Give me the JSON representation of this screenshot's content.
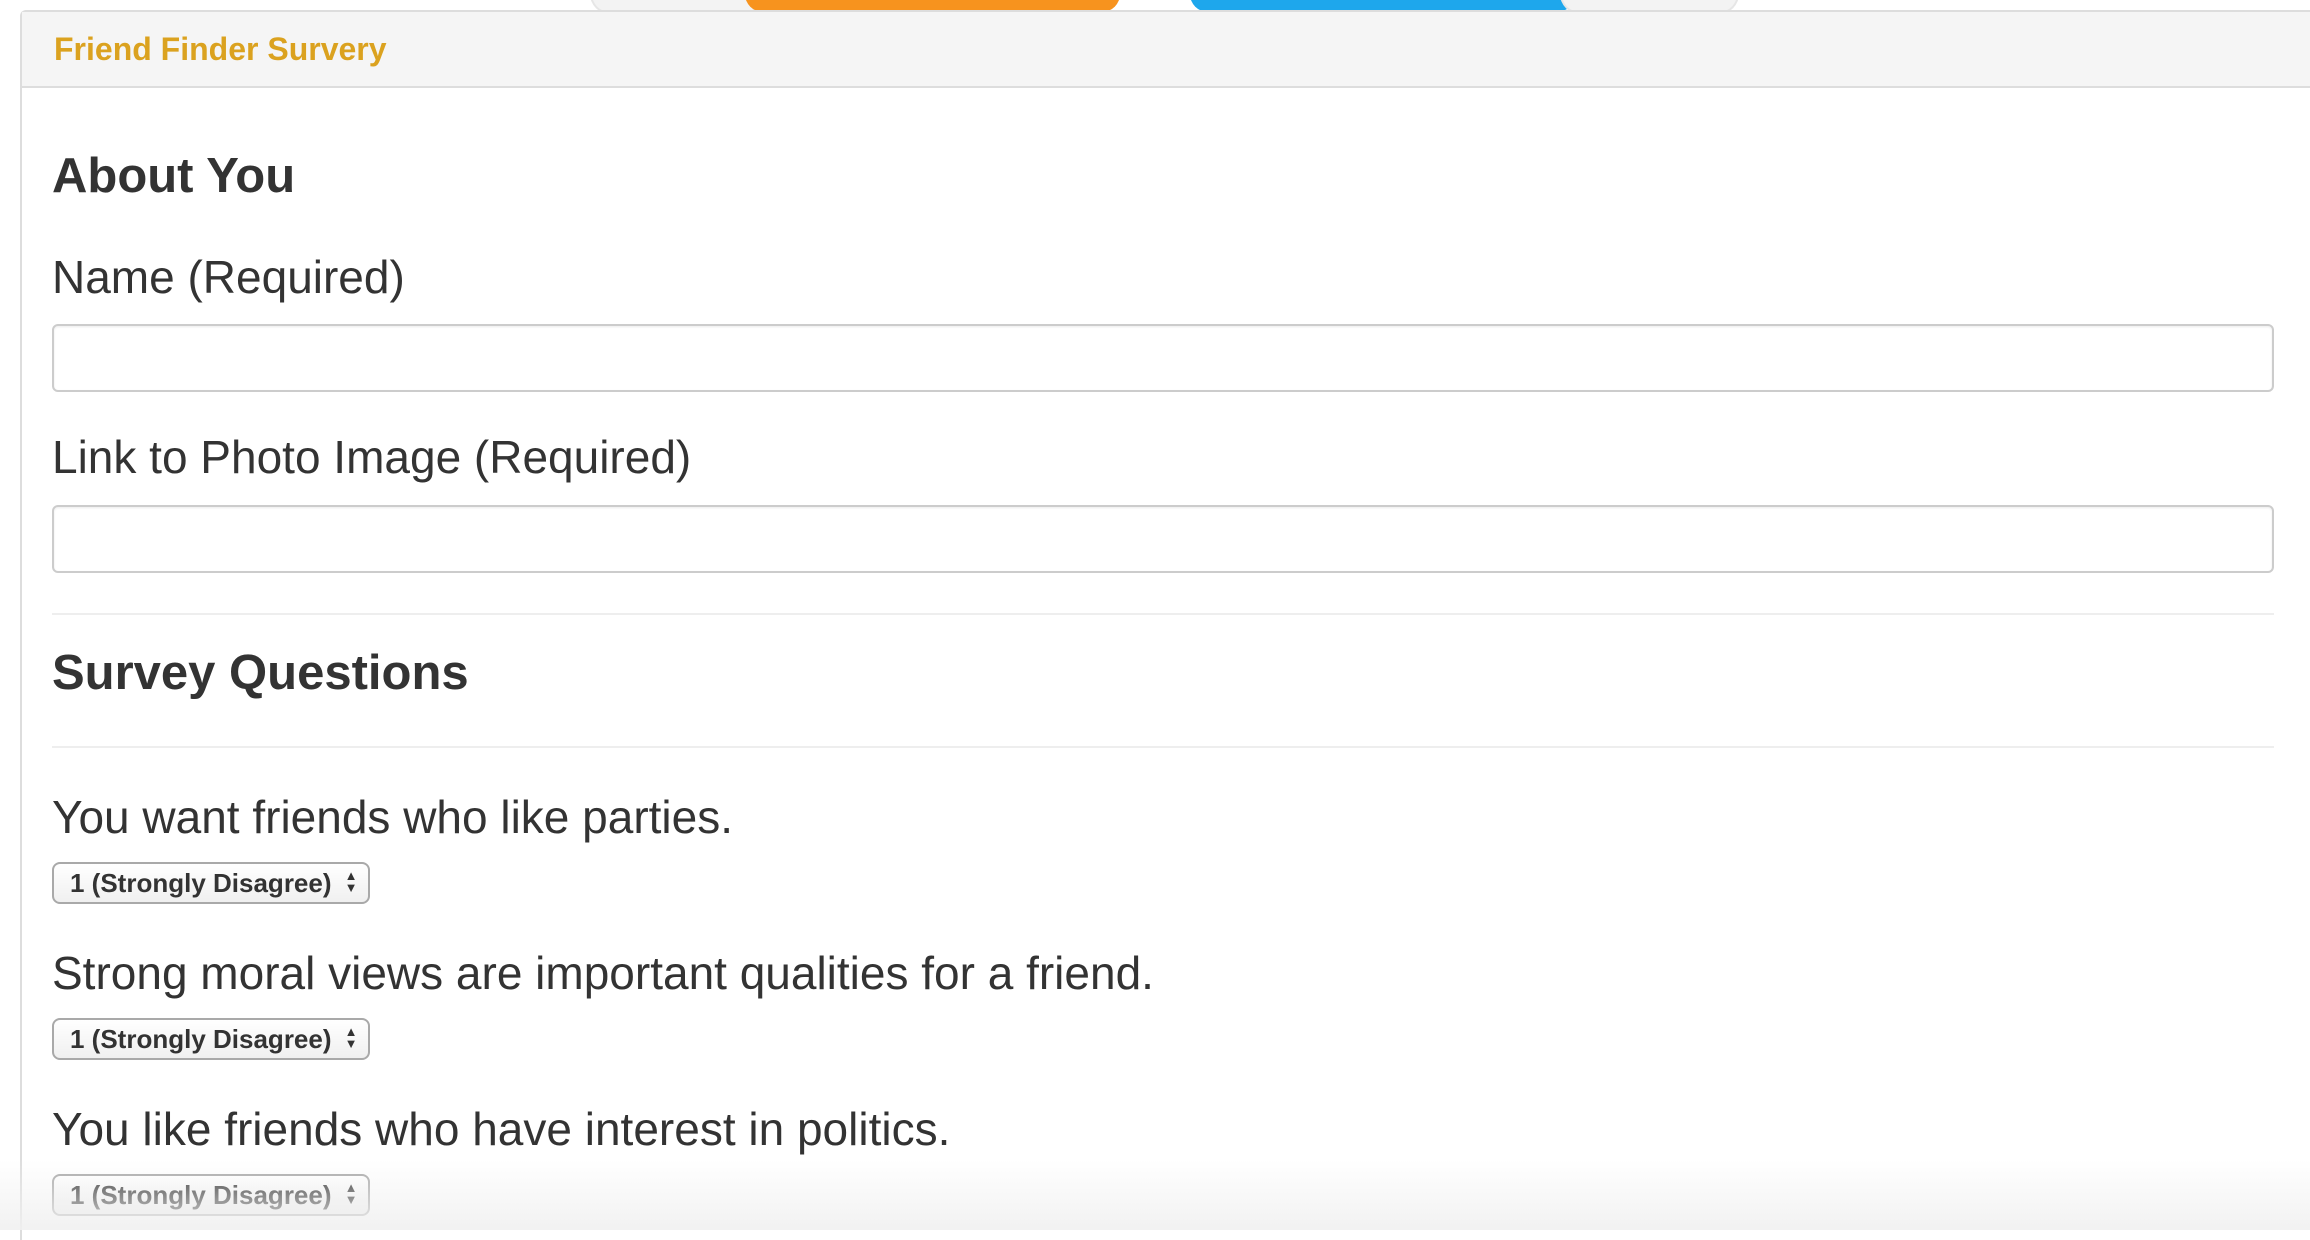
{
  "panel": {
    "title": "Friend Finder Survery"
  },
  "about": {
    "heading": "About You",
    "name_label": "Name (Required)",
    "name_value": "",
    "photo_label": "Link to Photo Image (Required)",
    "photo_value": ""
  },
  "survey": {
    "heading": "Survey Questions",
    "questions": [
      {
        "text": "You want friends who like parties.",
        "selected": "1 (Strongly Disagree)"
      },
      {
        "text": "Strong moral views are important qualities for a friend.",
        "selected": "1 (Strongly Disagree)"
      },
      {
        "text": "You like friends who have interest in politics.",
        "selected": "1 (Strongly Disagree)"
      }
    ]
  },
  "colors": {
    "title": "#dba21f",
    "heading_bg": "#f5f5f5",
    "text": "#333333",
    "border": "#dddddd"
  }
}
